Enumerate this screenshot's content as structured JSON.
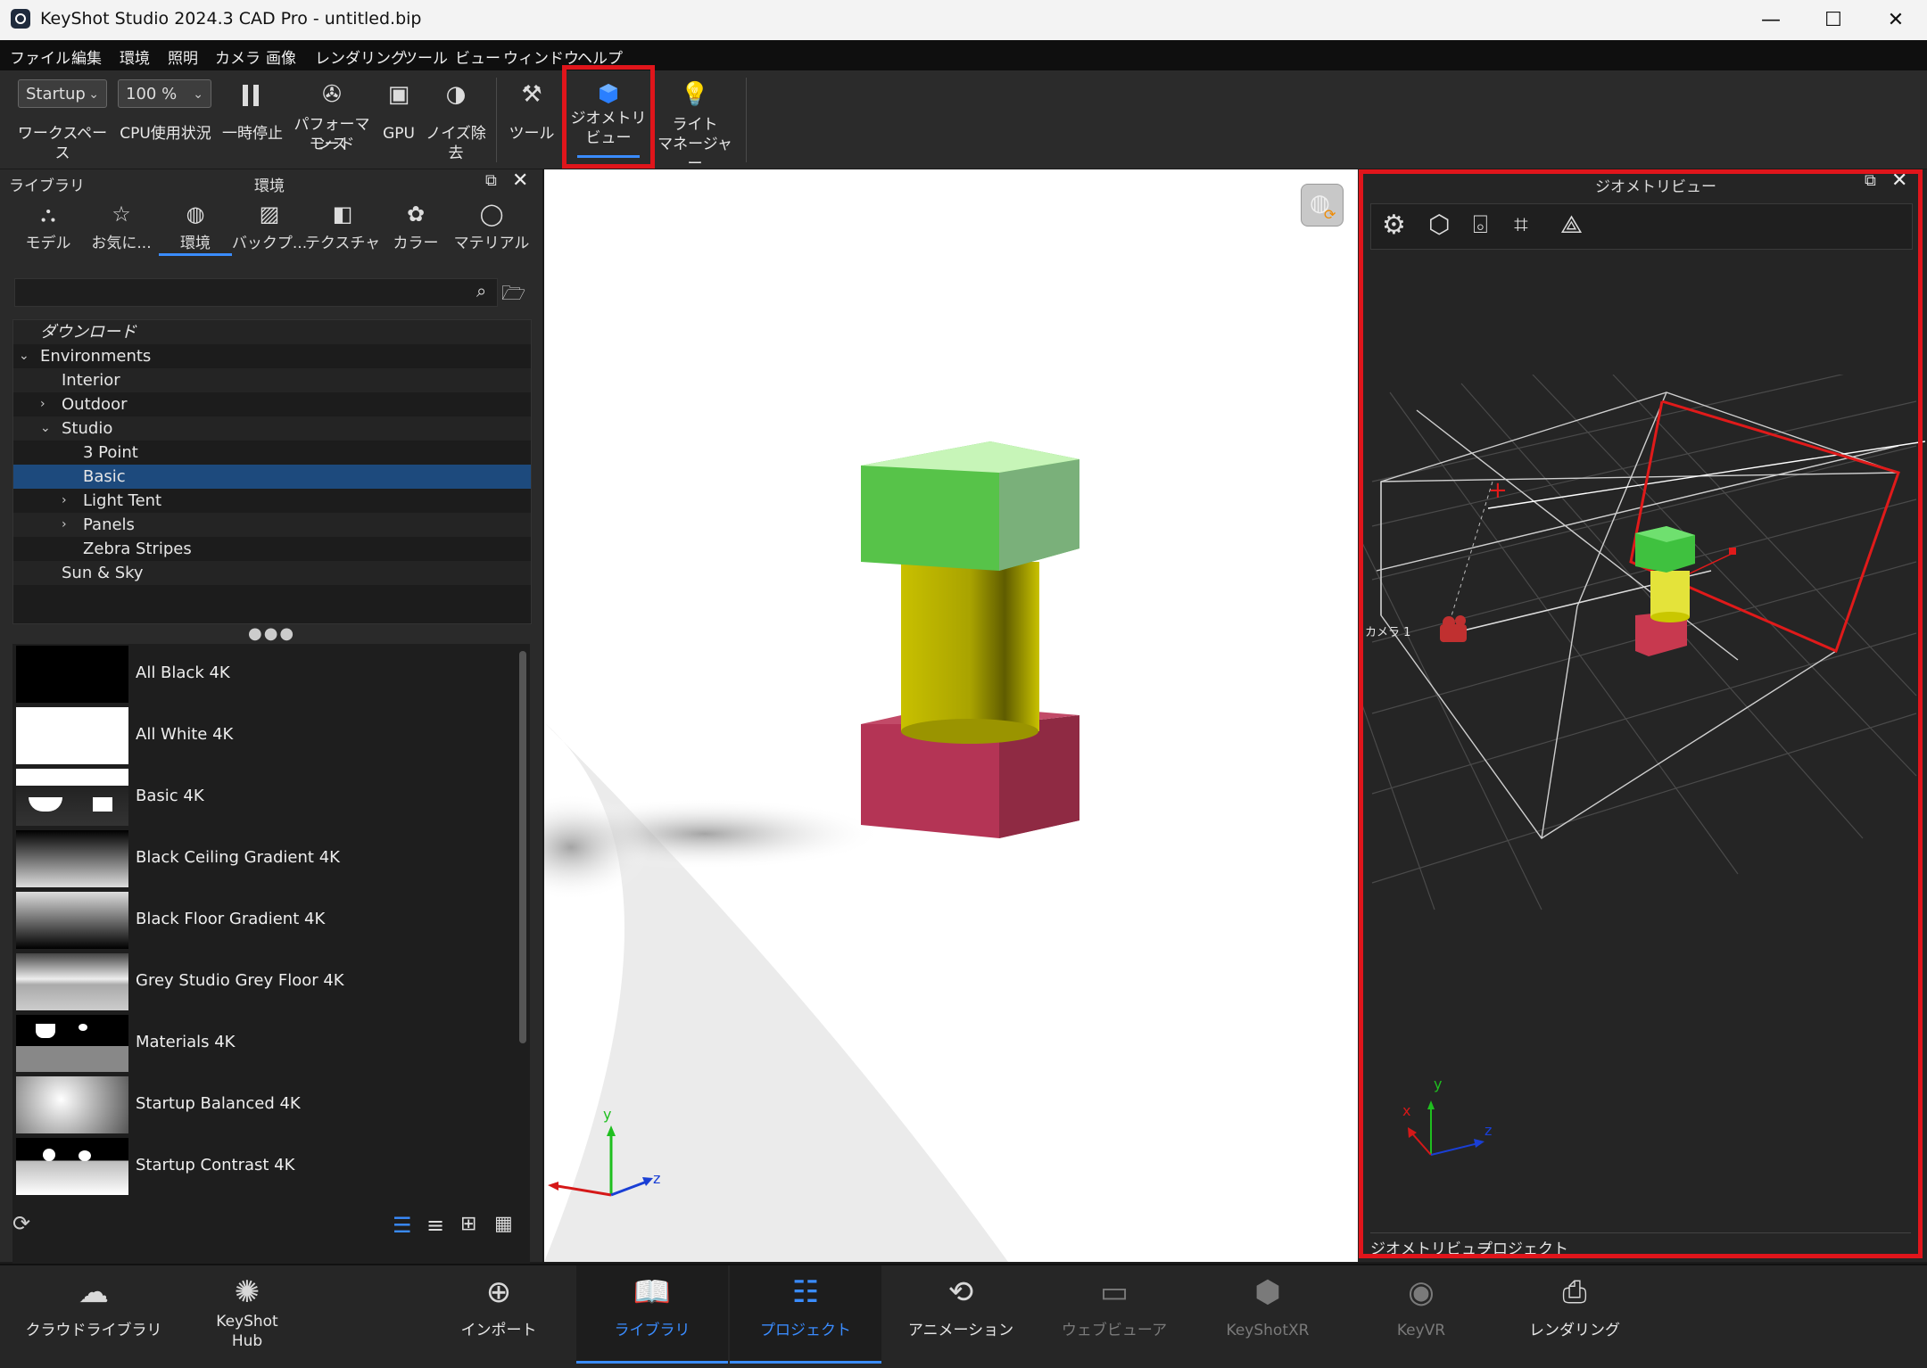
{
  "window": {
    "title": "KeyShot Studio 2024.3 CAD Pro - untitled.bip",
    "minimize": "—",
    "maximize": "☐",
    "close": "✕"
  },
  "menu": [
    "ファイル",
    "編集",
    "環境",
    "照明",
    "カメラ",
    "画像",
    "レンダリング",
    "ツール",
    "ビュー",
    "ウィンドウ",
    "ヘルプ"
  ],
  "toolbar": {
    "workspace_value": "Startup",
    "workspace_label": "ワークスペース",
    "cpu_value": "100 %",
    "cpu_label": "CPU使用状況",
    "pause_label": "一時停止",
    "perf_label_1": "パフォーマンス",
    "perf_label_2": "モード",
    "gpu_label": "GPU",
    "denoise_label": "ノイズ除去",
    "tools_label": "ツール",
    "geoview_label_1": "ジオメトリ",
    "geoview_label_2": "ビュー",
    "light_label_1": "ライト",
    "light_label_2": "マネージャー"
  },
  "library": {
    "panel_title": "ライブラリ",
    "section_title": "環境",
    "tabs": [
      {
        "label": "モデル",
        "icon": "models-icon"
      },
      {
        "label": "お気に...",
        "icon": "star-icon"
      },
      {
        "label": "環境",
        "icon": "globe-icon"
      },
      {
        "label": "バックプ...",
        "icon": "image-icon"
      },
      {
        "label": "テクスチャ",
        "icon": "texture-icon"
      },
      {
        "label": "カラー",
        "icon": "palette-icon"
      },
      {
        "label": "マテリアル",
        "icon": "material-icon"
      }
    ],
    "active_tab": 2,
    "search_placeholder": "",
    "tree": [
      {
        "label": "ダウンロード",
        "indent": 0,
        "caret": "",
        "italic": true
      },
      {
        "label": "Environments",
        "indent": 0,
        "caret": "open"
      },
      {
        "label": "Interior",
        "indent": 1,
        "caret": ""
      },
      {
        "label": "Outdoor",
        "indent": 1,
        "caret": "closed"
      },
      {
        "label": "Studio",
        "indent": 1,
        "caret": "open"
      },
      {
        "label": "3 Point",
        "indent": 2,
        "caret": ""
      },
      {
        "label": "Basic",
        "indent": 2,
        "caret": "",
        "selected": true
      },
      {
        "label": "Light Tent",
        "indent": 2,
        "caret": "closed"
      },
      {
        "label": "Panels",
        "indent": 2,
        "caret": "closed"
      },
      {
        "label": "Zebra Stripes",
        "indent": 2,
        "caret": ""
      },
      {
        "label": "Sun & Sky",
        "indent": 1,
        "caret": ""
      }
    ],
    "items": [
      "All Black 4K",
      "All White 4K",
      "Basic 4K",
      "Black Ceiling Gradient 4K",
      "Black Floor Gradient 4K",
      "Grey Studio Grey Floor 4K",
      "Materials 4K",
      "Startup Balanced 4K",
      "Startup Contrast 4K"
    ]
  },
  "viewport": {
    "axis_y": "y",
    "axis_z": "z"
  },
  "geometry_view": {
    "title": "ジオメトリビュー",
    "camera_label": "カメラ 1",
    "axis_x": "x",
    "axis_y": "y",
    "axis_z": "z",
    "tabs": [
      "ジオメトリビュー",
      "プロジェクト"
    ]
  },
  "bottom": [
    {
      "label": "クラウドライブラリ",
      "icon": "cloud-library-icon",
      "state": "normal"
    },
    {
      "label": "KeyShot\nHub",
      "icon": "keyshot-hub-icon",
      "state": "normal"
    },
    {
      "label": "インポート",
      "icon": "import-icon",
      "state": "normal"
    },
    {
      "label": "ライブラリ",
      "icon": "library-book-icon",
      "state": "active"
    },
    {
      "label": "プロジェクト",
      "icon": "project-icon",
      "state": "active"
    },
    {
      "label": "アニメーション",
      "icon": "animation-icon",
      "state": "normal"
    },
    {
      "label": "ウェブビューア",
      "icon": "web-viewer-icon",
      "state": "dim"
    },
    {
      "label": "KeyShotXR",
      "icon": "keyshotxr-icon",
      "state": "dim"
    },
    {
      "label": "KeyVR",
      "icon": "keyvr-icon",
      "state": "dim"
    },
    {
      "label": "レンダリング",
      "icon": "render-icon",
      "state": "normal"
    }
  ],
  "colors": {
    "highlight_red": "#e0151b",
    "selection_blue": "#1d4a7d",
    "active_blue": "#3a8cff"
  }
}
